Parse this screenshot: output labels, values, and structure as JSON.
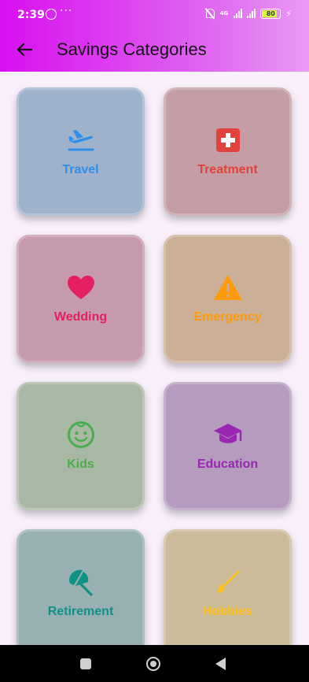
{
  "status_bar": {
    "time": "2:39",
    "dots": "···",
    "network_label": "4G",
    "battery_level": "80"
  },
  "header": {
    "title": "Savings Categories",
    "back_icon": "arrow-left-icon"
  },
  "categories": [
    {
      "label": "Travel",
      "icon": "flight-takeoff-icon",
      "bg": "#9fb2cc",
      "fg": "#2f8fe8"
    },
    {
      "label": "Treatment",
      "icon": "medical-cross-icon",
      "bg": "#c49ea4",
      "fg": "#e2423d"
    },
    {
      "label": "Wedding",
      "icon": "heart-icon",
      "bg": "#c69bad",
      "fg": "#e41f62"
    },
    {
      "label": "Emergency",
      "icon": "warning-icon",
      "bg": "#cbb097",
      "fg": "#ff9a0a"
    },
    {
      "label": "Kids",
      "icon": "child-face-icon",
      "bg": "#a9b8a5",
      "fg": "#4aae4f"
    },
    {
      "label": "Education",
      "icon": "graduation-cap-icon",
      "bg": "#b59bbd",
      "fg": "#9a27b2"
    },
    {
      "label": "Retirement",
      "icon": "beach-umbrella-icon",
      "bg": "#98b0b1",
      "fg": "#0f9184"
    },
    {
      "label": "Hobbies",
      "icon": "brush-icon",
      "bg": "#cdbc9b",
      "fg": "#ffc21c"
    }
  ],
  "colors": {
    "header_gradient_start": "#d80ff0",
    "header_gradient_end": "#ea9af6",
    "background": "#f9f0fb",
    "nav_bar": "#000000"
  }
}
